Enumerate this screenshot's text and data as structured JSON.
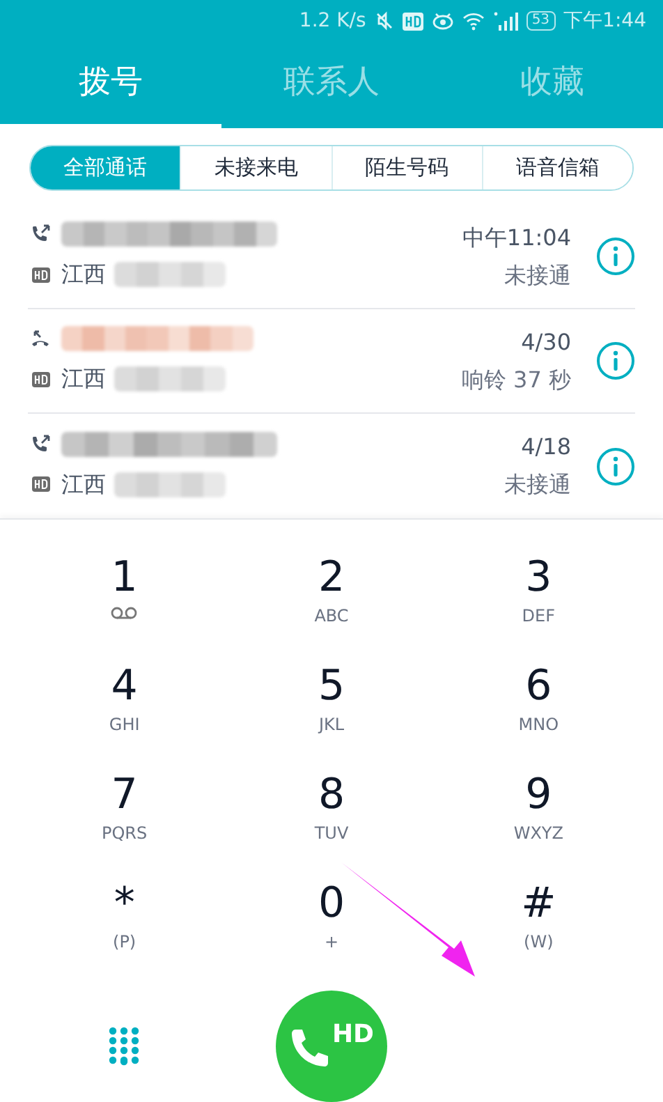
{
  "status_bar": {
    "speed": "1.2 K/s",
    "battery": "53",
    "time": "下午1:44"
  },
  "tabs": [
    {
      "label": "拨号",
      "selected": true
    },
    {
      "label": "联系人",
      "selected": false
    },
    {
      "label": "收藏",
      "selected": false
    }
  ],
  "filters": [
    {
      "label": "全部通话",
      "selected": true
    },
    {
      "label": "未接来电",
      "selected": false
    },
    {
      "label": "陌生号码",
      "selected": false
    },
    {
      "label": "语音信箱",
      "selected": false
    }
  ],
  "calls": [
    {
      "kind": "outgoing",
      "location": "江西",
      "time": "中午11:04",
      "status": "未接通"
    },
    {
      "kind": "missed",
      "location": "江西",
      "time": "4/30",
      "status": "响铃 37 秒"
    },
    {
      "kind": "outgoing",
      "location": "江西",
      "time": "4/18",
      "status": "未接通"
    }
  ],
  "keypad": [
    {
      "digit": "1",
      "kind": "voicemail"
    },
    {
      "digit": "2",
      "kind": "letters",
      "letters": "ABC"
    },
    {
      "digit": "3",
      "kind": "letters",
      "letters": "DEF"
    },
    {
      "digit": "4",
      "kind": "letters",
      "letters": "GHI"
    },
    {
      "digit": "5",
      "kind": "letters",
      "letters": "JKL"
    },
    {
      "digit": "6",
      "kind": "letters",
      "letters": "MNO"
    },
    {
      "digit": "7",
      "kind": "letters",
      "letters": "PQRS"
    },
    {
      "digit": "8",
      "kind": "letters",
      "letters": "TUV"
    },
    {
      "digit": "9",
      "kind": "letters",
      "letters": "WXYZ"
    },
    {
      "digit": "*",
      "kind": "letters",
      "letters": "(P)"
    },
    {
      "digit": "0",
      "kind": "letters",
      "letters": "+"
    },
    {
      "digit": "#",
      "kind": "letters",
      "letters": "(W)"
    }
  ],
  "call_button": {
    "label": "HD"
  }
}
